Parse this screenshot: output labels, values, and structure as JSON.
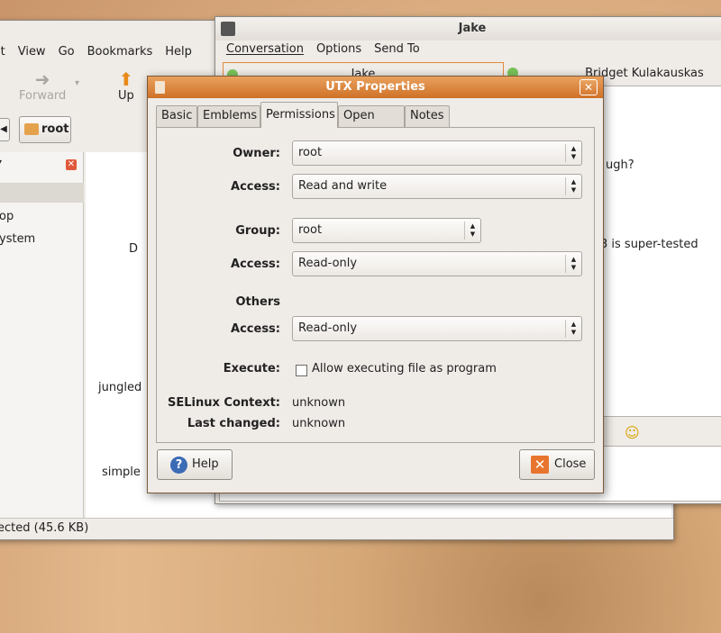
{
  "nautilus": {
    "menus": [
      "it",
      "View",
      "Go",
      "Bookmarks",
      "Help"
    ],
    "toolbar": {
      "forward": "Forward",
      "up": "Up"
    },
    "path_button": "root",
    "sidebar_items": [
      "op",
      "ystem"
    ],
    "files": [
      "D",
      "jungled",
      "simple"
    ],
    "status": "ected (45.6 KB)"
  },
  "pidgin": {
    "title": "Jake",
    "menus": [
      "Conversation",
      "Options",
      "Send To"
    ],
    "tabs": [
      "Jake",
      "Bridget Kulakauskas"
    ],
    "conversation_lines": [
      "ugh?",
      "3 is super-tested"
    ]
  },
  "dialog": {
    "title": "UTX Properties",
    "tabs": [
      "Basic",
      "Emblems",
      "Permissions",
      "Open With",
      "Notes"
    ],
    "active_tab": "Permissions",
    "owner_label": "Owner:",
    "owner_value": "root",
    "owner_access_label": "Access:",
    "owner_access_value": "Read and write",
    "group_label": "Group:",
    "group_value": "root",
    "group_access_label": "Access:",
    "group_access_value": "Read-only",
    "others_label": "Others",
    "others_access_label": "Access:",
    "others_access_value": "Read-only",
    "execute_label": "Execute:",
    "execute_checkbox_label": "Allow executing file as program",
    "execute_checked": false,
    "selinux_label": "SELinux Context:",
    "selinux_value": "unknown",
    "last_changed_label": "Last changed:",
    "last_changed_value": "unknown",
    "help_button": "Help",
    "close_button": "Close"
  },
  "colors": {
    "titlebar_accent": "#d57a32",
    "desktop": "#d6a878"
  }
}
